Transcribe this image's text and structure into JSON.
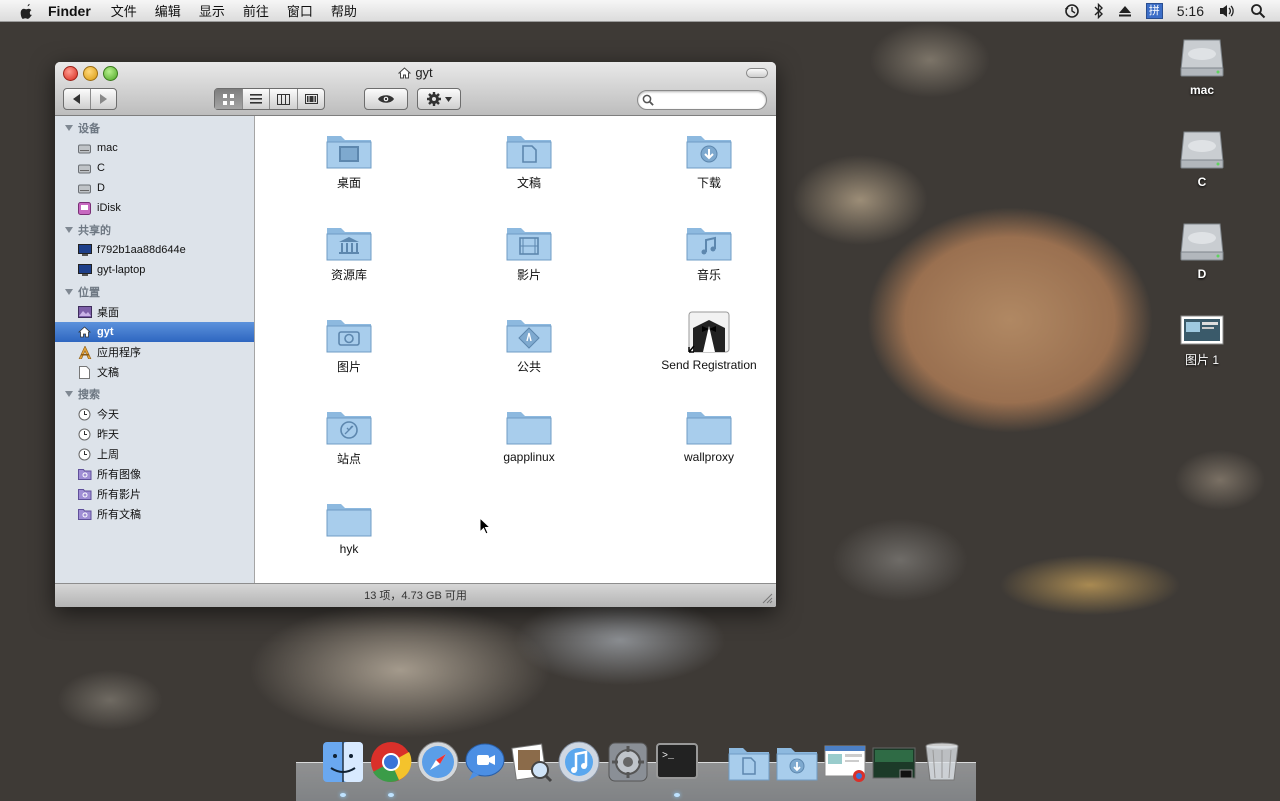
{
  "menubar": {
    "app_name": "Finder",
    "menus": [
      "文件",
      "编辑",
      "显示",
      "前往",
      "窗口",
      "帮助"
    ],
    "ime_label": "拼",
    "clock": "5:16",
    "status_icons": [
      "time-machine-icon",
      "bluetooth-icon",
      "eject-icon",
      "input-method-icon",
      "volume-icon",
      "spotlight-icon"
    ]
  },
  "window": {
    "title": "gyt",
    "search_placeholder": "",
    "status": "13 项，4.73 GB 可用"
  },
  "sidebar": {
    "sections": [
      {
        "title": "设备",
        "items": [
          {
            "label": "mac",
            "icon": "hard-drive-icon"
          },
          {
            "label": "C",
            "icon": "hard-drive-icon"
          },
          {
            "label": "D",
            "icon": "hard-drive-icon"
          },
          {
            "label": "iDisk",
            "icon": "idisk-icon"
          }
        ]
      },
      {
        "title": "共享的",
        "items": [
          {
            "label": "f792b1aa88d644e",
            "icon": "network-computer-icon"
          },
          {
            "label": "gyt-laptop",
            "icon": "network-computer-icon"
          }
        ]
      },
      {
        "title": "位置",
        "items": [
          {
            "label": "桌面",
            "icon": "desktop-icon"
          },
          {
            "label": "gyt",
            "icon": "home-icon",
            "selected": true
          },
          {
            "label": "应用程序",
            "icon": "applications-icon"
          },
          {
            "label": "文稿",
            "icon": "documents-icon"
          }
        ]
      },
      {
        "title": "搜索",
        "items": [
          {
            "label": "今天",
            "icon": "clock-icon"
          },
          {
            "label": "昨天",
            "icon": "clock-icon"
          },
          {
            "label": "上周",
            "icon": "clock-icon"
          },
          {
            "label": "所有图像",
            "icon": "smart-folder-icon"
          },
          {
            "label": "所有影片",
            "icon": "smart-folder-icon"
          },
          {
            "label": "所有文稿",
            "icon": "smart-folder-icon"
          }
        ]
      }
    ]
  },
  "content": {
    "items": [
      {
        "label": "桌面",
        "icon": "desktop-folder-icon"
      },
      {
        "label": "文稿",
        "icon": "documents-folder-icon"
      },
      {
        "label": "下载",
        "icon": "downloads-folder-icon"
      },
      {
        "label": "资源库",
        "icon": "library-folder-icon"
      },
      {
        "label": "影片",
        "icon": "movies-folder-icon"
      },
      {
        "label": "音乐",
        "icon": "music-folder-icon"
      },
      {
        "label": "图片",
        "icon": "pictures-folder-icon"
      },
      {
        "label": "公共",
        "icon": "public-folder-icon"
      },
      {
        "label": "Send Registration",
        "icon": "send-registration-alias-icon"
      },
      {
        "label": "站点",
        "icon": "sites-folder-icon"
      },
      {
        "label": "gapplinux",
        "icon": "folder-icon"
      },
      {
        "label": "wallproxy",
        "icon": "folder-icon"
      },
      {
        "label": "hyk",
        "icon": "folder-icon"
      }
    ]
  },
  "desktop": {
    "icons": [
      {
        "label": "mac",
        "icon": "hard-drive-icon"
      },
      {
        "label": "C",
        "icon": "hard-drive-icon"
      },
      {
        "label": "D",
        "icon": "hard-drive-icon"
      },
      {
        "label": "图片 1",
        "icon": "screenshot-file-icon"
      }
    ]
  },
  "dock": {
    "apps": [
      "finder-icon",
      "chrome-icon",
      "safari-icon",
      "ichat-icon",
      "preview-icon",
      "itunes-icon",
      "system-preferences-icon",
      "terminal-icon",
      "documents-stack-icon",
      "downloads-stack-icon",
      "web-page-stack-icon",
      "window-thumbnail-icon",
      "trash-icon"
    ]
  }
}
